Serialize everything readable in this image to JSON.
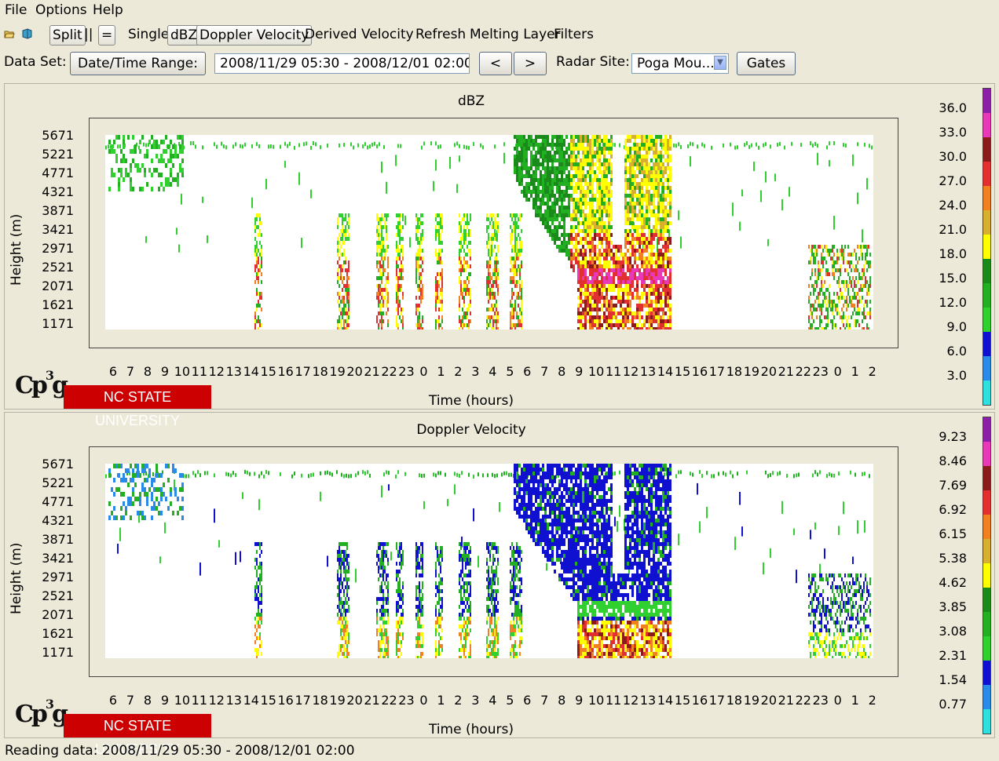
{
  "menu": [
    "File",
    "Options",
    "Help"
  ],
  "toolbar": {
    "split": "Split",
    "parallel": "||",
    "equal": "=",
    "single": "Single",
    "dbz": "dBZ",
    "doppler": "Doppler Velocity",
    "derived": "Derived Velocity",
    "refresh": "Refresh",
    "melting": "Melting Layer",
    "filters": "Filters",
    "icons": [
      "open-folder-icon",
      "book-icon"
    ]
  },
  "controls": {
    "dataset_label": "Data Set:",
    "datetime_button": "Date/Time Range:",
    "datetime_value": "2008/11/29 05:30 - 2008/12/01 02:00",
    "prev": "<",
    "next": ">",
    "radar_label": "Radar Site:",
    "radar_value": "Poga Mou...",
    "gates": "Gates"
  },
  "panels": [
    {
      "title": "dBZ",
      "ylabel": "Height (m)",
      "xlabel": "Time (hours)",
      "yticks": [
        "5671",
        "5221",
        "4771",
        "4321",
        "3871",
        "3421",
        "2971",
        "2521",
        "2071",
        "1621",
        "1171"
      ],
      "xticks": [
        "6",
        "7",
        "8",
        "9",
        "10",
        "11",
        "12",
        "13",
        "14",
        "15",
        "16",
        "17",
        "18",
        "19",
        "20",
        "21",
        "22",
        "23",
        "0",
        "1",
        "2",
        "3",
        "4",
        "5",
        "6",
        "7",
        "8",
        "9",
        "10",
        "11",
        "12",
        "13",
        "14",
        "15",
        "16",
        "17",
        "18",
        "19",
        "20",
        "21",
        "22",
        "23",
        "0",
        "1",
        "2"
      ],
      "colorbar_labels": [
        "36.0",
        "33.0",
        "30.0",
        "27.0",
        "24.0",
        "21.0",
        "18.0",
        "15.0",
        "12.0",
        "9.0",
        "6.0",
        "3.0"
      ]
    },
    {
      "title": "Doppler Velocity",
      "ylabel": "Height (m)",
      "xlabel": "Time (hours)",
      "yticks": [
        "5671",
        "5221",
        "4771",
        "4321",
        "3871",
        "3421",
        "2971",
        "2521",
        "2071",
        "1621",
        "1171"
      ],
      "xticks": [
        "6",
        "7",
        "8",
        "9",
        "10",
        "11",
        "12",
        "13",
        "14",
        "15",
        "16",
        "17",
        "18",
        "19",
        "20",
        "21",
        "22",
        "23",
        "0",
        "1",
        "2",
        "3",
        "4",
        "5",
        "6",
        "7",
        "8",
        "9",
        "10",
        "11",
        "12",
        "13",
        "14",
        "15",
        "16",
        "17",
        "18",
        "19",
        "20",
        "21",
        "22",
        "23",
        "0",
        "1",
        "2"
      ],
      "colorbar_labels": [
        "9.23",
        "8.46",
        "7.69",
        "6.92",
        "6.15",
        "5.38",
        "4.62",
        "3.85",
        "3.08",
        "2.31",
        "1.54",
        "0.77"
      ]
    }
  ],
  "colorbar_colors": [
    "#8b1fa8",
    "#e83ab8",
    "#8b1a1a",
    "#e23030",
    "#f08020",
    "#d8b030",
    "#ffff00",
    "#1a8a1a",
    "#22b022",
    "#30d030",
    "#1010d0",
    "#2a8ae8",
    "#30e0e0"
  ],
  "logo": {
    "cp": "Cp",
    "sup": "3",
    "g": "g",
    "university": "NC STATE UNIVERSITY"
  },
  "status": "Reading data: 2008/11/29 05:30 - 2008/12/01 02:00"
}
